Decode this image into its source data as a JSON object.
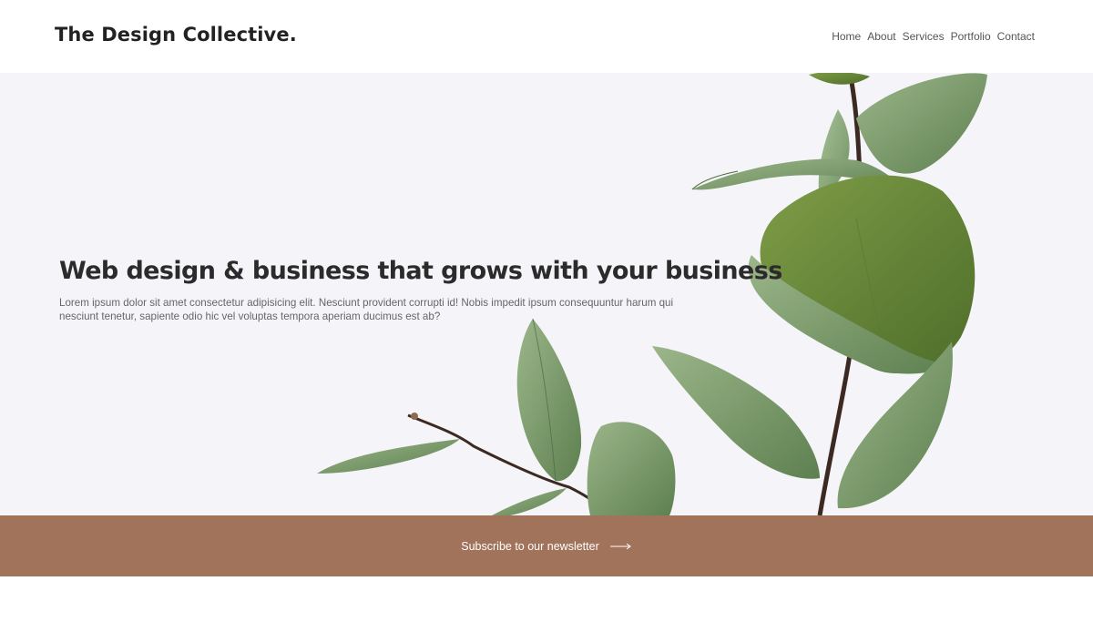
{
  "header": {
    "logo": "The Design Collective.",
    "nav": [
      {
        "label": "Home"
      },
      {
        "label": "About"
      },
      {
        "label": "Services"
      },
      {
        "label": "Portfolio"
      },
      {
        "label": "Contact"
      }
    ]
  },
  "hero": {
    "title": "Web design & business that grows with your business",
    "text": "Lorem ipsum dolor sit amet consectetur adipisicing elit. Nesciunt provident corrupti id! Nobis impedit ipsum consequuntur harum qui nesciunt tenetur, sapiente odio hic vel voluptas tempora aperiam ducimus est ab?",
    "image": "eucalyptus-leaves"
  },
  "newsletter": {
    "label": "Subscribe to our newsletter",
    "icon": "arrow-right-icon"
  },
  "colors": {
    "hero_bg": "#f5f5f9",
    "band": "#a1735a",
    "leaf_dark": "#6f8e3c",
    "leaf_light": "#8aa777",
    "stem": "#3c2a22"
  }
}
